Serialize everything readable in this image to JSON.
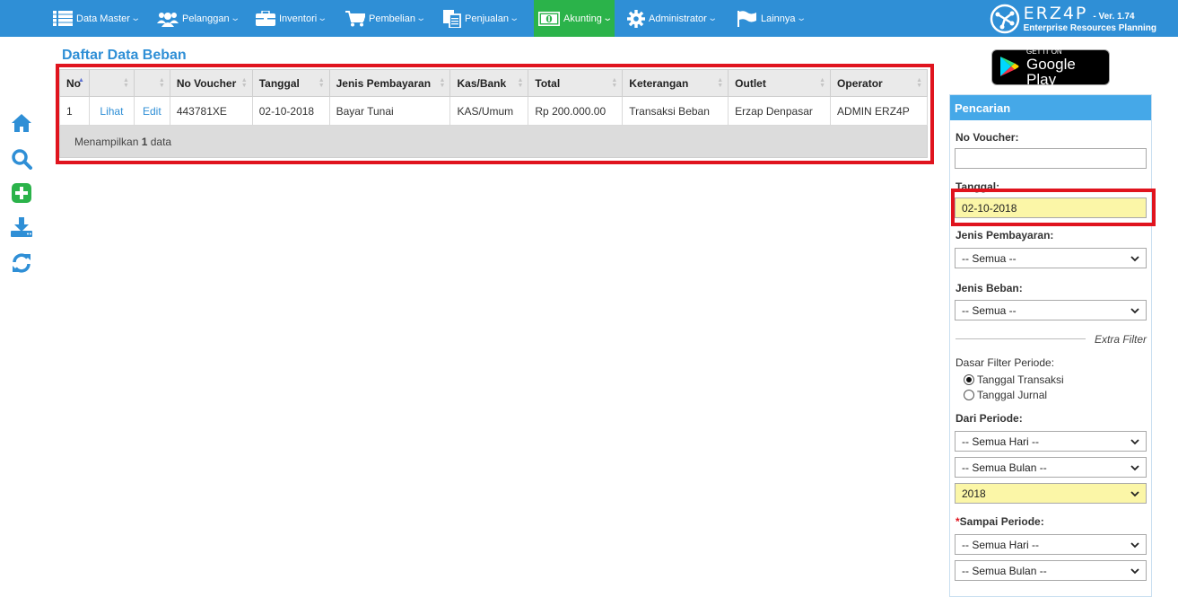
{
  "nav": {
    "items": [
      {
        "label": "Data Master",
        "icon": "list-icon"
      },
      {
        "label": "Pelanggan",
        "icon": "users-icon"
      },
      {
        "label": "Inventori",
        "icon": "briefcase-icon"
      },
      {
        "label": "Pembelian",
        "icon": "cart-icon"
      },
      {
        "label": "Penjualan",
        "icon": "documents-icon"
      },
      {
        "label": "Akunting",
        "icon": "money-icon",
        "active": true
      },
      {
        "label": "Administrator",
        "icon": "gear-icon"
      },
      {
        "label": "Lainnya",
        "icon": "flag-icon"
      }
    ],
    "brand_name": "ERZ4P",
    "version": "- Ver. 1.74",
    "brand_subtitle": "Enterprise Resources Planning",
    "active_color": "#2bb34a",
    "bar_color": "#2f8fd6"
  },
  "sidebar": {
    "icons": [
      "home-icon",
      "search-icon",
      "add-icon",
      "download-icon",
      "refresh-icon"
    ]
  },
  "main": {
    "title": "Daftar Data Beban",
    "table": {
      "headers": [
        "No",
        "",
        "",
        "No Voucher",
        "Tanggal",
        "Jenis Pembayaran",
        "Kas/Bank",
        "Total",
        "Keterangan",
        "Outlet",
        "Operator"
      ],
      "rows": [
        {
          "no": "1",
          "view": "Lihat",
          "edit": "Edit",
          "voucher": "443781XE",
          "tanggal": "02-10-2018",
          "jenis": "Bayar Tunai",
          "kas": "KAS/Umum",
          "total": "Rp 200.000.00",
          "keterangan": "Transaksi Beban",
          "outlet": "Erzap Denpasar",
          "operator": "ADMIN ERZ4P"
        }
      ],
      "footer_prefix": "Menampilkan",
      "footer_count": "1",
      "footer_suffix": "data"
    }
  },
  "right": {
    "gplay_small": "GET IT ON",
    "gplay_big": "Google Play",
    "panel_title": "Pencarian",
    "no_voucher_label": "No Voucher:",
    "no_voucher_value": "",
    "tanggal_label": "Tanggal:",
    "tanggal_value": "02-10-2018",
    "jenis_pembayaran_label": "Jenis Pembayaran:",
    "jenis_pembayaran_value": "-- Semua --",
    "jenis_beban_label": "Jenis Beban:",
    "jenis_beban_value": "-- Semua --",
    "extra_filter": "Extra Filter",
    "dasar_filter_label": "Dasar Filter Periode:",
    "radio_transaksi": "Tanggal Transaksi",
    "radio_jurnal": "Tanggal Jurnal",
    "radio_selected": "Tanggal Transaksi",
    "dari_periode_label": "Dari Periode:",
    "dari_hari": "-- Semua Hari --",
    "dari_bulan": "-- Semua Bulan --",
    "dari_tahun": "2018",
    "sampai_periode_label": "Sampai Periode:",
    "sampai_required_mark": "*",
    "sampai_hari": "-- Semua Hari --",
    "sampai_bulan": "-- Semua Bulan --"
  }
}
